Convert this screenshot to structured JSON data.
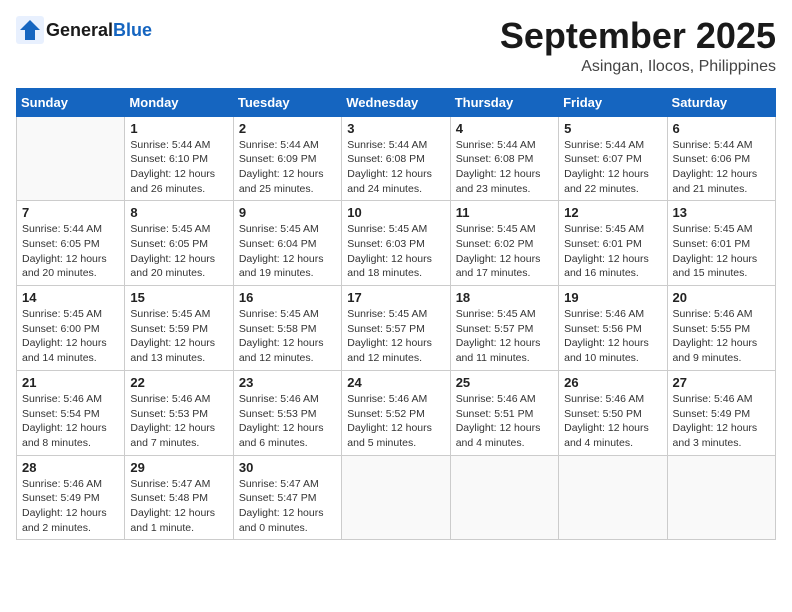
{
  "header": {
    "logo_general": "General",
    "logo_blue": "Blue",
    "month_title": "September 2025",
    "location": "Asingan, Ilocos, Philippines"
  },
  "days_of_week": [
    "Sunday",
    "Monday",
    "Tuesday",
    "Wednesday",
    "Thursday",
    "Friday",
    "Saturday"
  ],
  "weeks": [
    [
      {
        "day": "",
        "info": ""
      },
      {
        "day": "1",
        "info": "Sunrise: 5:44 AM\nSunset: 6:10 PM\nDaylight: 12 hours\nand 26 minutes."
      },
      {
        "day": "2",
        "info": "Sunrise: 5:44 AM\nSunset: 6:09 PM\nDaylight: 12 hours\nand 25 minutes."
      },
      {
        "day": "3",
        "info": "Sunrise: 5:44 AM\nSunset: 6:08 PM\nDaylight: 12 hours\nand 24 minutes."
      },
      {
        "day": "4",
        "info": "Sunrise: 5:44 AM\nSunset: 6:08 PM\nDaylight: 12 hours\nand 23 minutes."
      },
      {
        "day": "5",
        "info": "Sunrise: 5:44 AM\nSunset: 6:07 PM\nDaylight: 12 hours\nand 22 minutes."
      },
      {
        "day": "6",
        "info": "Sunrise: 5:44 AM\nSunset: 6:06 PM\nDaylight: 12 hours\nand 21 minutes."
      }
    ],
    [
      {
        "day": "7",
        "info": "Sunrise: 5:44 AM\nSunset: 6:05 PM\nDaylight: 12 hours\nand 20 minutes."
      },
      {
        "day": "8",
        "info": "Sunrise: 5:45 AM\nSunset: 6:05 PM\nDaylight: 12 hours\nand 20 minutes."
      },
      {
        "day": "9",
        "info": "Sunrise: 5:45 AM\nSunset: 6:04 PM\nDaylight: 12 hours\nand 19 minutes."
      },
      {
        "day": "10",
        "info": "Sunrise: 5:45 AM\nSunset: 6:03 PM\nDaylight: 12 hours\nand 18 minutes."
      },
      {
        "day": "11",
        "info": "Sunrise: 5:45 AM\nSunset: 6:02 PM\nDaylight: 12 hours\nand 17 minutes."
      },
      {
        "day": "12",
        "info": "Sunrise: 5:45 AM\nSunset: 6:01 PM\nDaylight: 12 hours\nand 16 minutes."
      },
      {
        "day": "13",
        "info": "Sunrise: 5:45 AM\nSunset: 6:01 PM\nDaylight: 12 hours\nand 15 minutes."
      }
    ],
    [
      {
        "day": "14",
        "info": "Sunrise: 5:45 AM\nSunset: 6:00 PM\nDaylight: 12 hours\nand 14 minutes."
      },
      {
        "day": "15",
        "info": "Sunrise: 5:45 AM\nSunset: 5:59 PM\nDaylight: 12 hours\nand 13 minutes."
      },
      {
        "day": "16",
        "info": "Sunrise: 5:45 AM\nSunset: 5:58 PM\nDaylight: 12 hours\nand 12 minutes."
      },
      {
        "day": "17",
        "info": "Sunrise: 5:45 AM\nSunset: 5:57 PM\nDaylight: 12 hours\nand 12 minutes."
      },
      {
        "day": "18",
        "info": "Sunrise: 5:45 AM\nSunset: 5:57 PM\nDaylight: 12 hours\nand 11 minutes."
      },
      {
        "day": "19",
        "info": "Sunrise: 5:46 AM\nSunset: 5:56 PM\nDaylight: 12 hours\nand 10 minutes."
      },
      {
        "day": "20",
        "info": "Sunrise: 5:46 AM\nSunset: 5:55 PM\nDaylight: 12 hours\nand 9 minutes."
      }
    ],
    [
      {
        "day": "21",
        "info": "Sunrise: 5:46 AM\nSunset: 5:54 PM\nDaylight: 12 hours\nand 8 minutes."
      },
      {
        "day": "22",
        "info": "Sunrise: 5:46 AM\nSunset: 5:53 PM\nDaylight: 12 hours\nand 7 minutes."
      },
      {
        "day": "23",
        "info": "Sunrise: 5:46 AM\nSunset: 5:53 PM\nDaylight: 12 hours\nand 6 minutes."
      },
      {
        "day": "24",
        "info": "Sunrise: 5:46 AM\nSunset: 5:52 PM\nDaylight: 12 hours\nand 5 minutes."
      },
      {
        "day": "25",
        "info": "Sunrise: 5:46 AM\nSunset: 5:51 PM\nDaylight: 12 hours\nand 4 minutes."
      },
      {
        "day": "26",
        "info": "Sunrise: 5:46 AM\nSunset: 5:50 PM\nDaylight: 12 hours\nand 4 minutes."
      },
      {
        "day": "27",
        "info": "Sunrise: 5:46 AM\nSunset: 5:49 PM\nDaylight: 12 hours\nand 3 minutes."
      }
    ],
    [
      {
        "day": "28",
        "info": "Sunrise: 5:46 AM\nSunset: 5:49 PM\nDaylight: 12 hours\nand 2 minutes."
      },
      {
        "day": "29",
        "info": "Sunrise: 5:47 AM\nSunset: 5:48 PM\nDaylight: 12 hours\nand 1 minute."
      },
      {
        "day": "30",
        "info": "Sunrise: 5:47 AM\nSunset: 5:47 PM\nDaylight: 12 hours\nand 0 minutes."
      },
      {
        "day": "",
        "info": ""
      },
      {
        "day": "",
        "info": ""
      },
      {
        "day": "",
        "info": ""
      },
      {
        "day": "",
        "info": ""
      }
    ]
  ]
}
